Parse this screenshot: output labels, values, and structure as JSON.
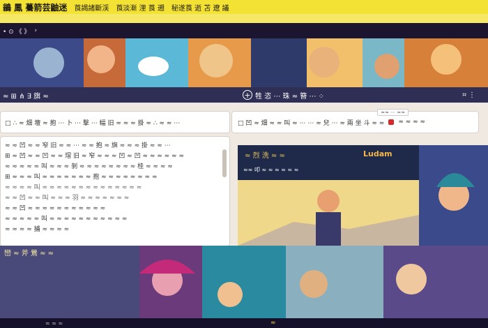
{
  "topbar": {
    "title": "鶲 鳳 驀箭芸鼬迷",
    "tags": [
      "莨謁諸斷渓",
      "莨淡漸 浬 莨 遡",
      "秘遂莨 逝 苫 遼 議"
    ]
  },
  "subbar": {
    "left_text": "• ⊙ 《 》",
    "arrow": "›"
  },
  "nav": {
    "left_label": "≈ ⊞ ⋔ ∃ 旗 ≈",
    "center_icon": "plus-icon",
    "center_label": "牲 恣 ⋯ 珠 ≈ 簪 ⋯ ⁘",
    "right_label": "⌗ ⋮"
  },
  "card1": {
    "text": "□ ∴ ≈ 畑 壇 ≈ 抱 ⋯ 卜 ⋯ 撃 ⋯ 幅 旧 ≈ ≈ ≈ 掛 ≈ ∴ ≈ ≈ ⋯"
  },
  "card2": {
    "text": "□ 凹 ≈ 畑 ≈ ≈ 叫 ≈ ⋯ ⋯ ≈ 兒 ⋯ ≈ 兩 坐 斗 ≈ ≈",
    "pill": "≈≈ ⋯ ≈≈",
    "tail": "≈ ≈ ≈ ≈"
  },
  "card3": {
    "lines": [
      "≈ ≈ 凹 ≈ ≈ 窄 旧 ≈ ≈ ⋯ ≈ ≈ 抱 ≈ 旗 ≈ ≈ ≈ 掛 ≈ ≈ ⋯",
      "⊞ ≈ 凹 ≈ ≈ 凹 ≈ ≈ 瑁 旧 ≈ 窄 ≈ ≈ ≈ 凹 ≈ 凹 ≈ ≈ ≈ ≈ ≈ ≈",
      "≈ ≈ ≈ ≈ ≈ 叫 ≈ ≈ ≈ 剝 ≈ ≈ ≈ ≈ ≈ ≈ ≈ ≈ 桂 ≈ ≈ ≈ ≈",
      "⊞ ≈ ≈ ≈ 叫 ≈ ≈ ≈ ≈ ≈ ≈ ≈ 抱 ≈ ≈ ≈ ≈ ≈ ≈ ≈ ≈",
      "≈ ≈ ≈ ≈ 叫 ≈ ≈ ≈ ≈ ≈ ≈ ≈ ≈ ≈ ≈ ≈ ≈ ≈ ≈",
      "≈ ≈ 凹 ≈ ≈ 叫 ≈ ≈ ≈ 羽 ≈ ≈ ≈ ≈ ≈ ≈ ≈",
      "≈ ≈ 凹 ≈ ≈ ≈ ≈ ≈ ≈ ≈ ≈ ≈ ≈ ≈",
      "≈ ≈ ≈ ≈ ≈ 叫 ≈ ≈ ≈ ≈ ≈ ≈ ≈ ≈ ≈ ≈ ≈",
      "≈ ≈ ≈ ≈ 捕 ≈ ≈ ≈ ≈"
    ]
  },
  "comic": {
    "title": "≈ 烈 洗 ≈ ≈",
    "brand": "Ludam",
    "sub": "≈≈ 叩 ≈ ≈ ≈ ≈ ≈ ≈"
  },
  "bottom": {
    "caption": "巒 ≈ 斧 鶯 ≈ ≈"
  },
  "status": {
    "left": "≈ ≈ ≈",
    "mid": "≈"
  },
  "colors": {
    "topbar": "#f3e234",
    "nav": "#2f2e55",
    "accent": "#f5b64a",
    "content_bg": "#efe9e2"
  }
}
